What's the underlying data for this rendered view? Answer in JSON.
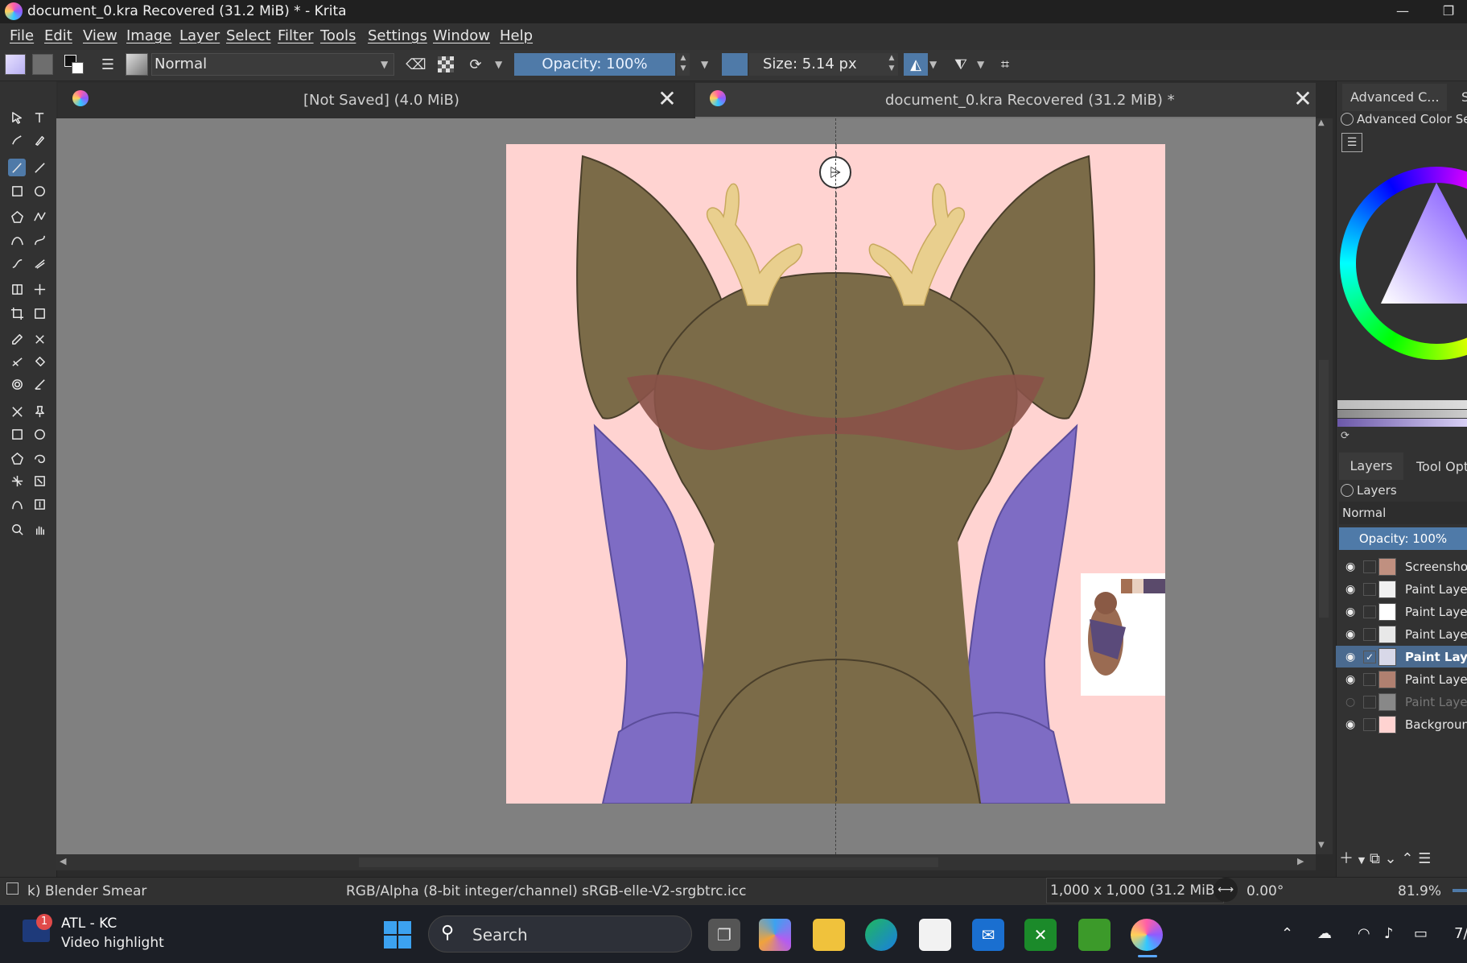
{
  "window": {
    "title": "document_0.kra Recovered (31.2 MiB) * - Krita",
    "minimize": "—",
    "maximize": "❐"
  },
  "menu": [
    "File",
    "Edit",
    "View",
    "Image",
    "Layer",
    "Select",
    "Filter",
    "Tools",
    "Settings",
    "Window",
    "Help"
  ],
  "toolbar": {
    "blend_mode": "Normal",
    "opacity": "Opacity: 100%",
    "size": "Size: 5.14 px"
  },
  "tabs": [
    {
      "label": "[Not Saved]  (4.0 MiB)",
      "close": "✕"
    },
    {
      "label": "document_0.kra Recovered (31.2 MiB) *",
      "close": "✕"
    }
  ],
  "docker": {
    "top_tabs": [
      "Advanced C...",
      "S"
    ],
    "color_selector_title": "Advanced Color Sele",
    "layer_tabs": [
      "Layers",
      "Tool Opti"
    ],
    "layers_title": "Layers",
    "blend_mode": "Normal",
    "opacity": "Opacity:  100%",
    "layers": [
      {
        "name": "Screensho",
        "visible": true,
        "active": false
      },
      {
        "name": "Paint Laye",
        "visible": true,
        "active": false
      },
      {
        "name": "Paint Laye",
        "visible": true,
        "active": false
      },
      {
        "name": "Paint Laye",
        "visible": true,
        "active": false
      },
      {
        "name": "Paint Lay",
        "visible": true,
        "active": true
      },
      {
        "name": "Paint Laye",
        "visible": true,
        "active": false
      },
      {
        "name": "Paint Laye",
        "visible": false,
        "active": false
      },
      {
        "name": "Backgroun",
        "visible": true,
        "active": false
      }
    ]
  },
  "status": {
    "brush": "k) Blender Smear",
    "color_space": "RGB/Alpha (8-bit integer/channel)  sRGB-elle-V2-srgbtrc.icc",
    "image_size": "1,000 x 1,000 (31.2 MiB)",
    "rotation": "0.00°",
    "zoom": "81.9%"
  },
  "taskbar": {
    "widget_title": "ATL - KC",
    "widget_subtitle": "Video highlight",
    "widget_badge": "1",
    "search_label": "Search",
    "clock_partial": "7/"
  },
  "colors": {
    "canvas_bg": "#ffd3d1",
    "fur_brown": "#7b6b48",
    "mane_purple": "#7e6cc4",
    "antler": "#e9cf8e",
    "muzzle_band": "#8a5248",
    "accent_blue": "#4f7aa8"
  }
}
